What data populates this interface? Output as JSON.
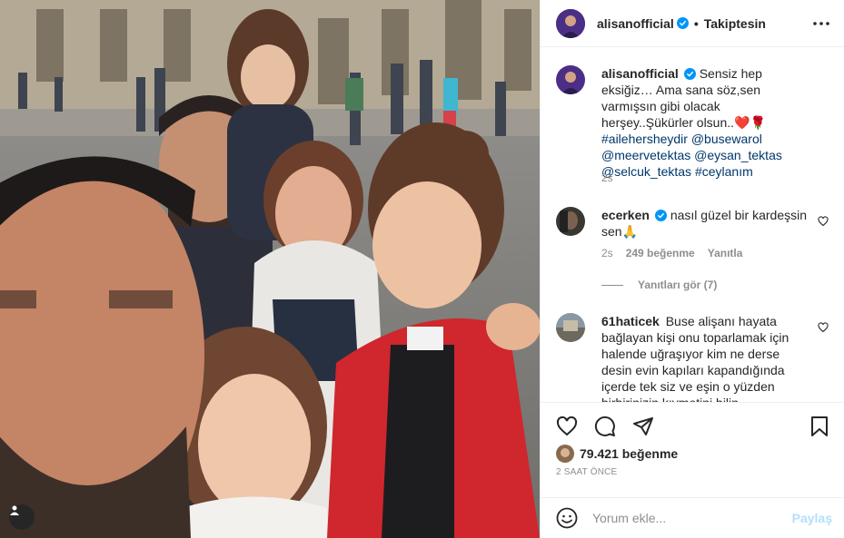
{
  "post": {
    "username": "alisanofficial",
    "follow_separator": "•",
    "follow_status": "Takiptesin",
    "more_icon": "ellipsis-icon"
  },
  "caption": {
    "username": "alisanofficial",
    "text": "Sensiz hep eksiğiz… Ama sana söz,sen varmışsın gibi olacak herşey..Şükürler olsun..",
    "heart_emoji": "❤️",
    "extra_glyph": "🌹",
    "tags": [
      "#ailehersheydir",
      "@busewarol",
      "@meervetektas",
      "@eysan_tektas",
      "@selcuk_tektas",
      "#ceylanım"
    ],
    "time": "2s"
  },
  "comments": [
    {
      "username": "ecerken",
      "verified": true,
      "text": "nasıl güzel bir kardeşsin sen",
      "emoji": "🙏",
      "time": "2s",
      "likes": "249 beğenme",
      "reply": "Yanıtla"
    },
    {
      "username": "61haticek",
      "verified": false,
      "text": "Buse alişanı hayata bağlayan kişi onu toparlamak için halende uğraşıyor kim ne derse desin evin kapıları kapandığında içerde tek siz ve eşin o yüzden birbirinizin kıymetini bilin"
    }
  ],
  "view_replies": "Yanıtları gör (7)",
  "actions": {
    "like_icon": "heart-icon",
    "comment_icon": "comment-icon",
    "share_icon": "share-icon",
    "save_icon": "bookmark-icon"
  },
  "likes_count": "79.421 beğenme",
  "posted_ago": "2 SAAT ÖNCE",
  "comment_box": {
    "placeholder": "Yorum ekle...",
    "post_label": "Paylaş"
  },
  "colors": {
    "link": "#00376b",
    "verified": "#0095f6",
    "muted": "#8e8e8e",
    "post_disabled": "#b2dffc"
  }
}
